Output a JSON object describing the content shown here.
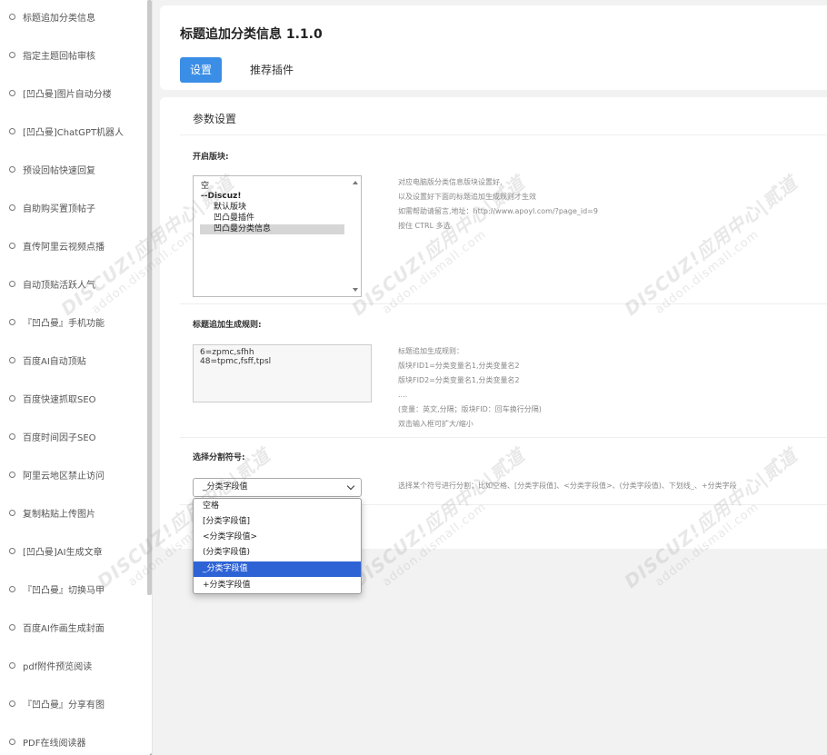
{
  "sidebar": {
    "items": [
      {
        "label": "标题追加分类信息"
      },
      {
        "label": "指定主题回帖审核"
      },
      {
        "label": "[凹凸曼]图片自动分楼"
      },
      {
        "label": "[凹凸曼]ChatGPT机器人"
      },
      {
        "label": "预设回帖快速回复"
      },
      {
        "label": "自助购买置顶帖子"
      },
      {
        "label": "直传阿里云视频点播"
      },
      {
        "label": "自动顶贴活跃人气"
      },
      {
        "label": "『凹凸曼』手机功能"
      },
      {
        "label": "百度AI自动顶贴"
      },
      {
        "label": "百度快速抓取SEO"
      },
      {
        "label": "百度时间因子SEO"
      },
      {
        "label": "阿里云地区禁止访问"
      },
      {
        "label": "复制粘贴上传图片"
      },
      {
        "label": "[凹凸曼]AI生成文章"
      },
      {
        "label": "『凹凸曼』切换马甲"
      },
      {
        "label": "百度AI作画生成封面"
      },
      {
        "label": "pdf附件预览阅读"
      },
      {
        "label": "『凹凸曼』分享有图"
      },
      {
        "label": "PDF在线阅读器"
      }
    ]
  },
  "header": {
    "title": "标题追加分类信息 1.1.0",
    "tabs": [
      {
        "label": "设置",
        "active": true
      },
      {
        "label": "推荐插件",
        "active": false
      }
    ]
  },
  "settings": {
    "section_title": "参数设置",
    "forum_block": {
      "label": "开启版块:",
      "options": [
        "空",
        "--Discuz!",
        "默认版块",
        "凹凸曼插件",
        "凹凸曼分类信息"
      ],
      "selected": "凹凸曼分类信息",
      "help": [
        "对应电脑版分类信息版块设置好,",
        "以及设置好下面的标题追加生成规则才生效",
        "如需帮助请留言,地址：http://www.apoyl.com/?page_id=9",
        "按住 CTRL 多选"
      ]
    },
    "title_rules": {
      "label": "标题追加生成规则:",
      "value_lines": [
        "6=zpmc,sfhh",
        "48=tpmc,fsff,tpsl"
      ],
      "help": [
        "标题追加生成规则：",
        "版块FID1=分类变量名1,分类变量名2",
        "版块FID2=分类变量名1,分类变量名2",
        "....",
        "(变量：英文,分隔；版块FID：回车换行分隔)",
        "双击输入框可扩大/缩小"
      ]
    },
    "separator": {
      "label": "选择分割符号:",
      "selected": "_分类字段值",
      "options": [
        "空格",
        "[分类字段值]",
        "<分类字段值>",
        "(分类字段值)",
        "_分类字段值",
        "+分类字段值"
      ],
      "help": "选择某个符号进行分割；比如空格、[分类字段值]、<分类字段值>、(分类字段值)、下划线_、+分类字段"
    }
  },
  "watermark": {
    "line1": "DISCUZ!应用中心|贰道",
    "line2": "addon.dismall.com"
  }
}
